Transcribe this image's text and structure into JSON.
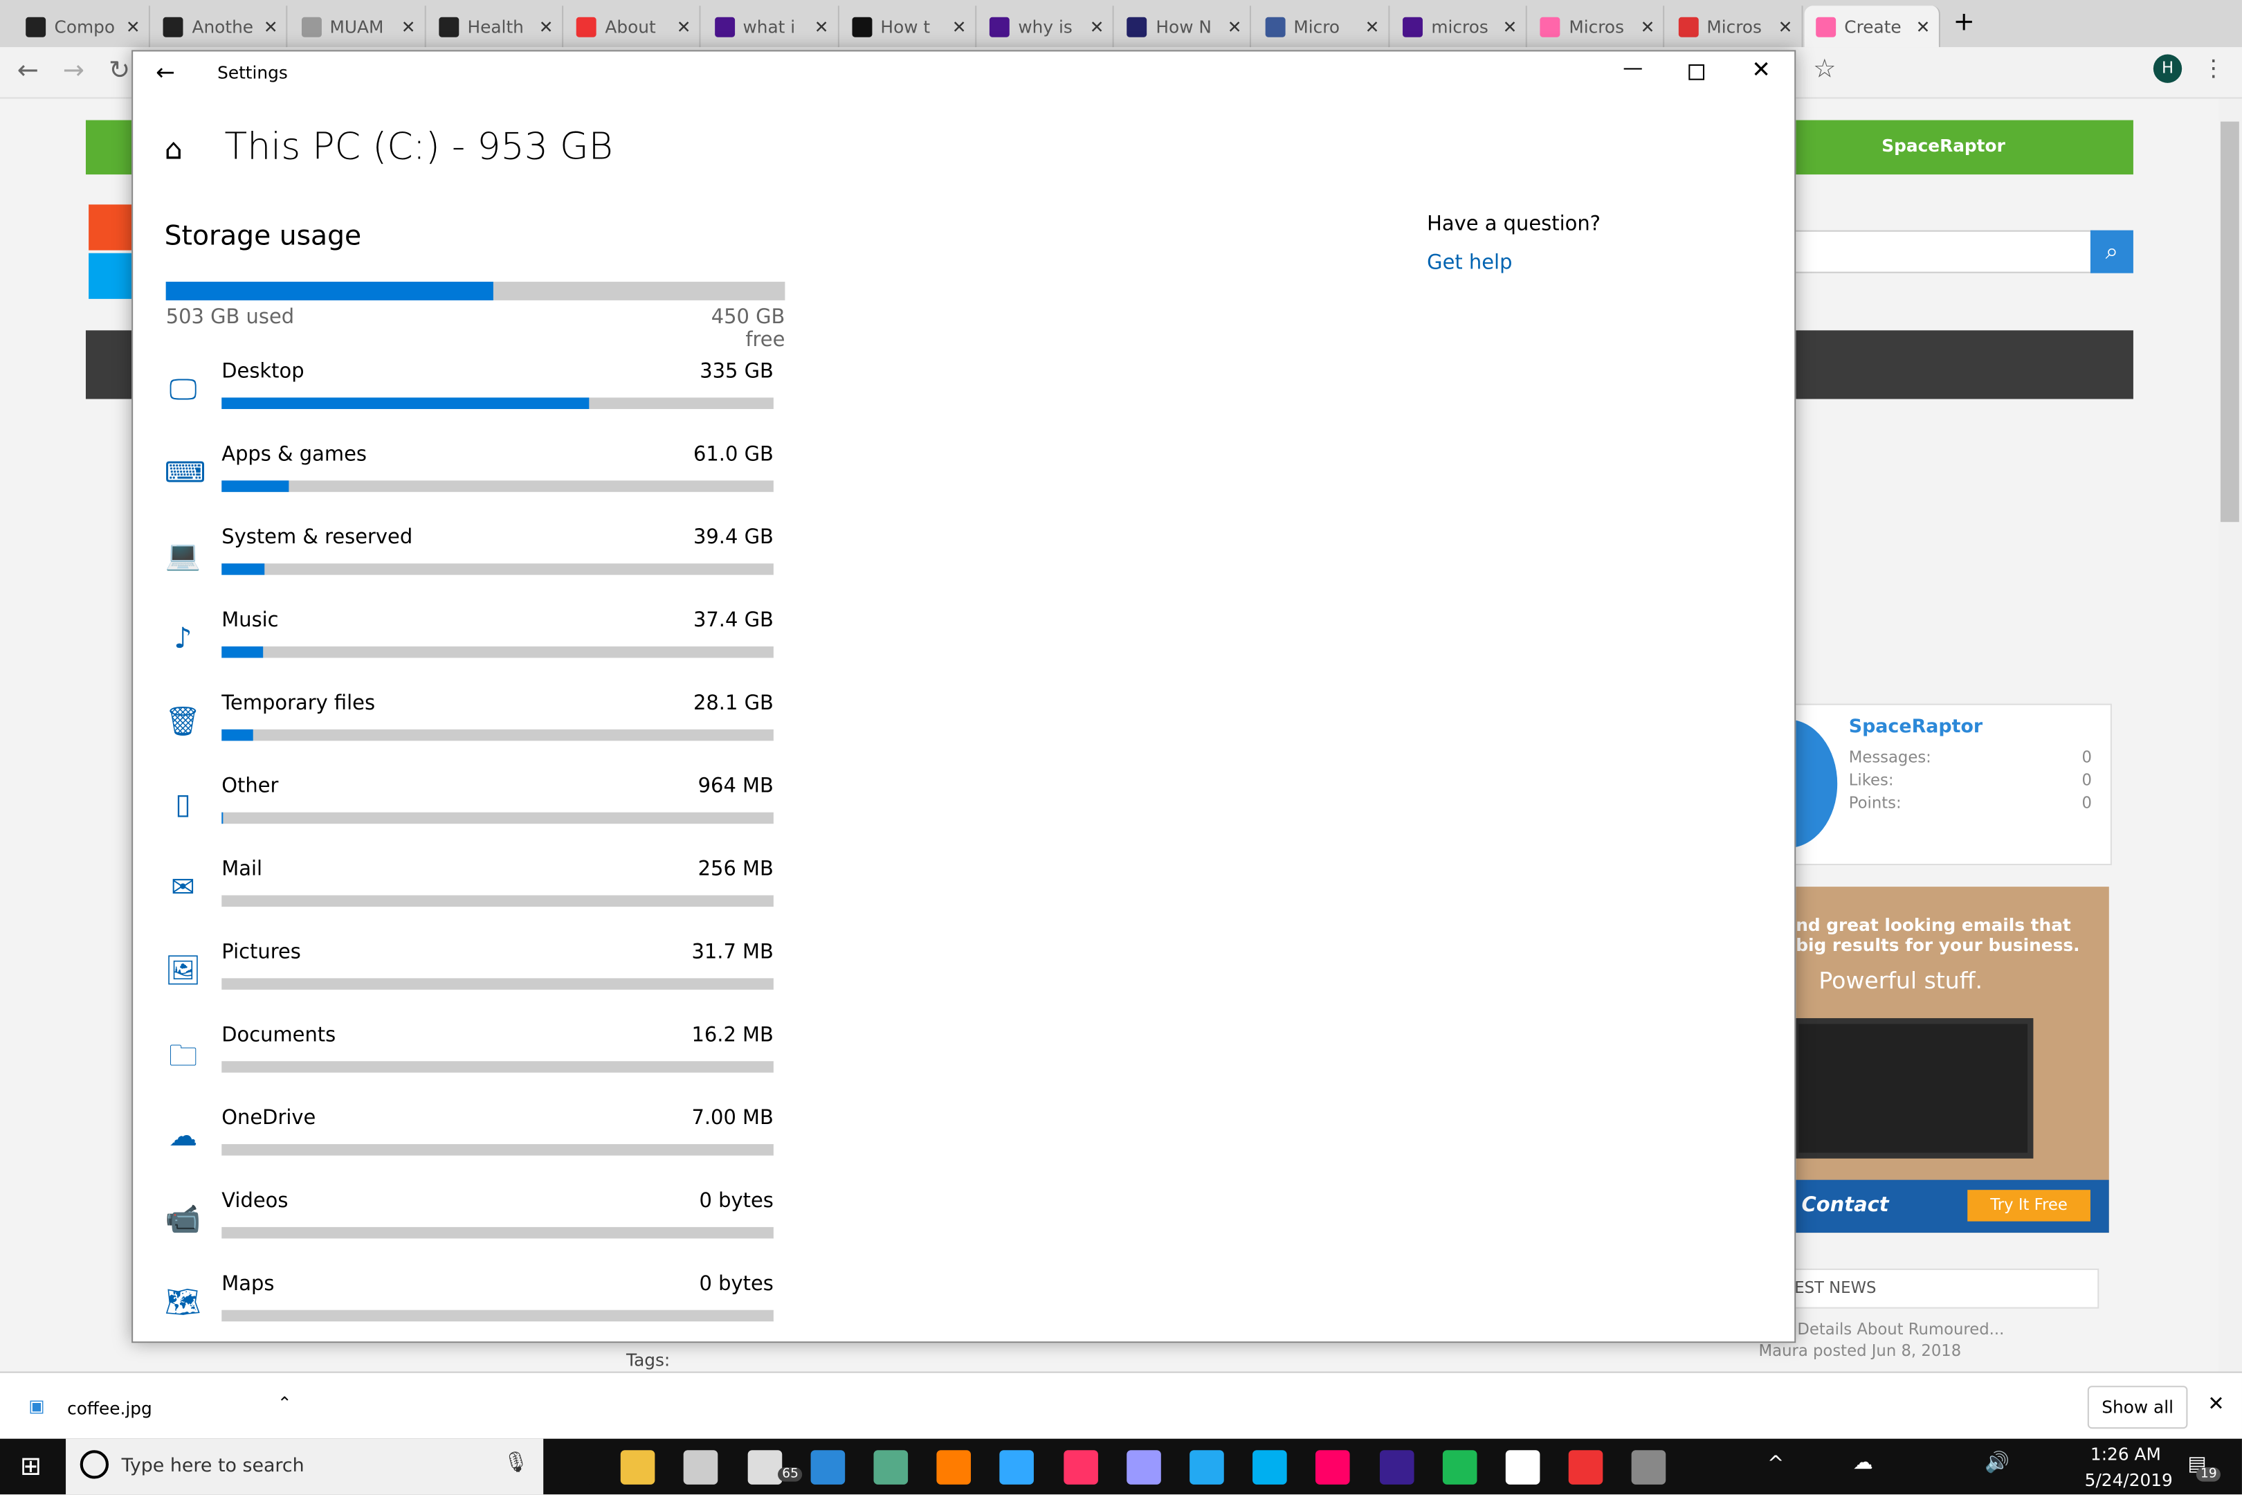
{
  "browser": {
    "tabs": [
      {
        "label": "Compo",
        "color": "#222"
      },
      {
        "label": "Anothe",
        "color": "#222"
      },
      {
        "label": "MUAM",
        "color": "#999"
      },
      {
        "label": "Health",
        "color": "#222"
      },
      {
        "label": "About",
        "color": "#e33"
      },
      {
        "label": "what i",
        "color": "#4a148c"
      },
      {
        "label": "How t",
        "color": "#111"
      },
      {
        "label": "why is",
        "color": "#4a148c"
      },
      {
        "label": "How N",
        "color": "#226"
      },
      {
        "label": "Micro",
        "color": "#3b5998"
      },
      {
        "label": "micros",
        "color": "#4a148c"
      },
      {
        "label": "Micros",
        "color": "#f6a"
      },
      {
        "label": "Micros",
        "color": "#d33"
      },
      {
        "label": "Create",
        "color": "#f6a"
      }
    ],
    "new_tab": "+",
    "profile_initial": "H"
  },
  "background_page": {
    "user": "SpaceRaptor",
    "profile_name": "SpaceRaptor",
    "stats": [
      {
        "label": "Messages:",
        "value": "0"
      },
      {
        "label": "Likes:",
        "value": "0"
      },
      {
        "label": "Points:",
        "value": "0"
      }
    ],
    "ad": {
      "line1": "nd great looking emails that",
      "line2": "big results for your business.",
      "line3": "Powerful stuff.",
      "brand": "Contact",
      "cta": "Try It Free"
    },
    "news_header": "EST NEWS",
    "news_item": "Details About Rumoured...",
    "news_meta": "Maura posted Jun 8, 2018",
    "tags_label": "Tags:"
  },
  "settings": {
    "window_title": "Settings",
    "page_title": "This PC (C:) - 953 GB",
    "section_title": "Storage usage",
    "used": "503 GB used",
    "free": "450 GB free",
    "used_fraction": 0.528,
    "help_title": "Have a question?",
    "help_link": "Get help",
    "accent": "#0078d7",
    "categories": [
      {
        "name": "Desktop",
        "size": "335 GB",
        "fraction": 0.666,
        "icon": "monitor-icon"
      },
      {
        "name": "Apps & games",
        "size": "61.0 GB",
        "fraction": 0.121,
        "icon": "keyboard-icon"
      },
      {
        "name": "System & reserved",
        "size": "39.4 GB",
        "fraction": 0.078,
        "icon": "laptop-icon"
      },
      {
        "name": "Music",
        "size": "37.4 GB",
        "fraction": 0.074,
        "icon": "music-icon"
      },
      {
        "name": "Temporary files",
        "size": "28.1 GB",
        "fraction": 0.056,
        "icon": "trash-icon"
      },
      {
        "name": "Other",
        "size": "964 MB",
        "fraction": 0.002,
        "icon": "other-icon"
      },
      {
        "name": "Mail",
        "size": "256 MB",
        "fraction": 0,
        "icon": "mail-icon"
      },
      {
        "name": "Pictures",
        "size": "31.7 MB",
        "fraction": 0,
        "icon": "picture-icon"
      },
      {
        "name": "Documents",
        "size": "16.2 MB",
        "fraction": 0,
        "icon": "documents-icon"
      },
      {
        "name": "OneDrive",
        "size": "7.00 MB",
        "fraction": 0,
        "icon": "cloud-icon"
      },
      {
        "name": "Videos",
        "size": "0 bytes",
        "fraction": 0,
        "icon": "video-icon"
      },
      {
        "name": "Maps",
        "size": "0 bytes",
        "fraction": 0,
        "icon": "map-icon"
      }
    ]
  },
  "downloads": {
    "file": "coffee.jpg",
    "show_all": "Show all"
  },
  "taskbar": {
    "search_placeholder": "Type here to search",
    "time": "1:26 AM",
    "date": "5/24/2019",
    "notifications": "19",
    "mail_badge": "65"
  }
}
